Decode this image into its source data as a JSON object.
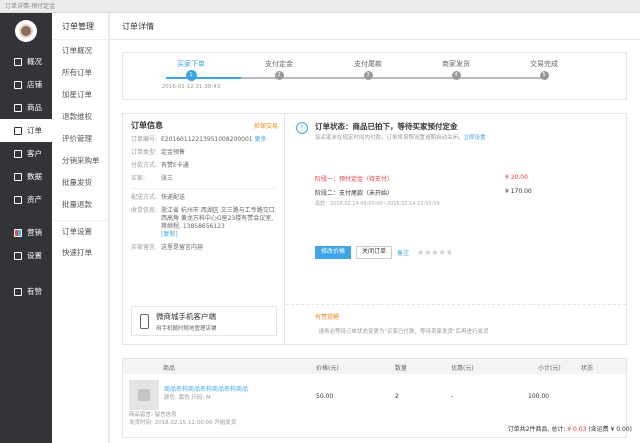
{
  "window": {
    "title": "订单详情-预付定金"
  },
  "nav": {
    "items": [
      {
        "label": "概况"
      },
      {
        "label": "店铺"
      },
      {
        "label": "商品"
      },
      {
        "label": "订单"
      },
      {
        "label": "客户"
      },
      {
        "label": "数据"
      },
      {
        "label": "资产"
      },
      {
        "label": "营销"
      },
      {
        "label": "设置"
      },
      {
        "label": "有赞"
      }
    ]
  },
  "subnav": {
    "title": "订单管理",
    "items": [
      "订单概况",
      "所有订单",
      "加星订单",
      "退款维权",
      "评价管理",
      "分销采购单",
      "批量发货",
      "批量退款",
      "订单设置",
      "快速打单"
    ]
  },
  "header": {
    "title": "订单详情"
  },
  "steps": {
    "items": [
      {
        "label": "买家下单",
        "num": "1",
        "time": "2016-01-12 21:38:43"
      },
      {
        "label": "支付定金",
        "num": "2"
      },
      {
        "label": "支付尾款",
        "num": "3"
      },
      {
        "label": "商家发货",
        "num": "4"
      },
      {
        "label": "交易完成",
        "num": "5"
      }
    ]
  },
  "order_info": {
    "title": "订单信息",
    "warn": "担保交易",
    "fields": [
      {
        "k": "订单编号:",
        "v": "E20160112213951008200001",
        "link": "更多"
      },
      {
        "k": "订单类型:",
        "v": "定金预售"
      },
      {
        "k": "付款方式:",
        "v": "有赞E卡通"
      },
      {
        "k": "买家:",
        "v": "张三"
      }
    ],
    "fields2": [
      {
        "k": "配送方式:",
        "v": "快递配送"
      },
      {
        "k": "收货信息:",
        "v": "浙江省 杭州市 西湖区 文三路与工专路交口西高角 黄龙万科中心G座23楼有赞会议室, 蒋继程, 13858656123",
        "link": "[复制]"
      },
      {
        "k": "买家留言:",
        "v": "这里是留言内容"
      }
    ],
    "mobile_title": "微商城手机客户端",
    "mobile_sub": "用手机随时随地管理店铺"
  },
  "status": {
    "title": "订单状态：商品已拍下，等待买家预付定金",
    "sub": "如买家未在规定时间内付款，订单将按照设置逾期自动关闭。",
    "sub_link": "立即设置",
    "stage1_label": "阶段一：预付定金（待支付）",
    "stage1_price": "¥ 20.00",
    "stage2_label": "阶段二：支付尾款（未开始）",
    "stage2_price": "¥ 170.00",
    "stage2_time": "尾款：2018.02.14 09:00:00~2018.02.14 23:59:59",
    "btn_price": "修改价格",
    "btn_close": "关闭订单",
    "remark": "备注",
    "stars": "★★★★★",
    "tips_title": "有赞提醒",
    "tips_body": "· 请务必等待订单状态变更为\"买家已付款，等待卖家发货\"后再进行发货"
  },
  "goods": {
    "headers": {
      "name": "商品",
      "price": "价格(元)",
      "qty": "数量",
      "discount": "优惠(元)",
      "subtotal": "小计(元)",
      "state": "状态"
    },
    "row": {
      "name": "商品名称商品名称商品名称商品",
      "spec": "颜色: 黄色   尺码: M",
      "price": "50.00",
      "qty": "2",
      "discount": "-",
      "subtotal": "100.00"
    },
    "remark": "商品留言: 留言信息",
    "ship_time": "发货时间: 2018.02.15 12:00:00 开始发货"
  },
  "footer": {
    "summary": "订单共2件商品, 总计:",
    "total": "¥ 0.03",
    "freight": "(含运费 ¥ 0.00)"
  }
}
